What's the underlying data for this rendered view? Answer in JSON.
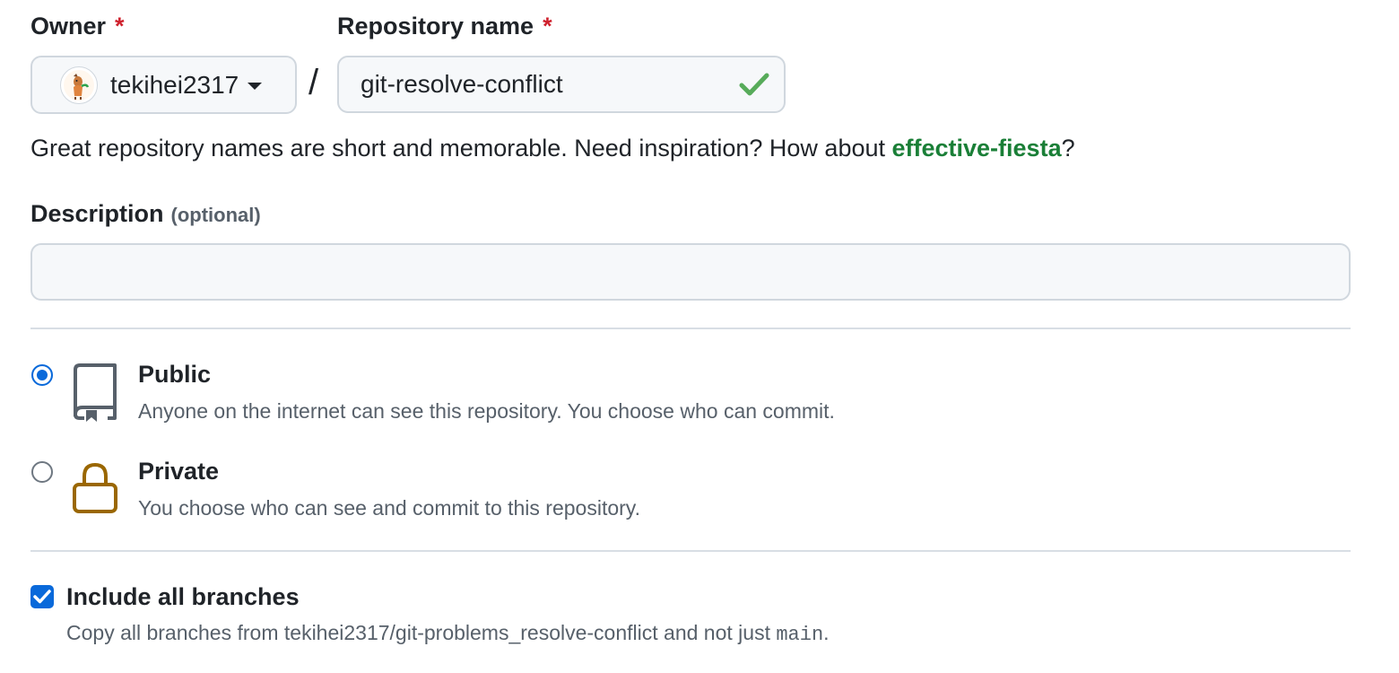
{
  "owner": {
    "label": "Owner",
    "required_mark": "*",
    "selected": "tekihei2317",
    "avatar_icon": "user-avatar-icon",
    "caret_icon": "caret-down-icon"
  },
  "separator": "/",
  "repository": {
    "label": "Repository name",
    "required_mark": "*",
    "value": "git-resolve-conflict",
    "valid_icon": "check-icon",
    "valid_color": "#1a7f37"
  },
  "hint": {
    "text_before": "Great repository names are short and memorable. Need inspiration? How about ",
    "suggestion": "effective-fiesta",
    "text_after": "?"
  },
  "description": {
    "label": "Description",
    "optional_label": "(optional)",
    "value": "",
    "placeholder": ""
  },
  "visibility": {
    "options": [
      {
        "title": "Public",
        "description": "Anyone on the internet can see this repository. You choose who can commit.",
        "selected": true,
        "icon": "repo-book-icon"
      },
      {
        "title": "Private",
        "description": "You choose who can see and commit to this repository.",
        "selected": false,
        "icon": "lock-icon"
      }
    ]
  },
  "branches": {
    "label": "Include all branches",
    "checked": true,
    "desc_before": "Copy all branches from tekihei2317/git-problems_resolve-conflict and not just ",
    "desc_code": "main",
    "desc_after": "."
  },
  "colors": {
    "accent": "#0969da",
    "required": "#cf222e",
    "success": "#1a7f37",
    "lock": "#9a6700"
  }
}
